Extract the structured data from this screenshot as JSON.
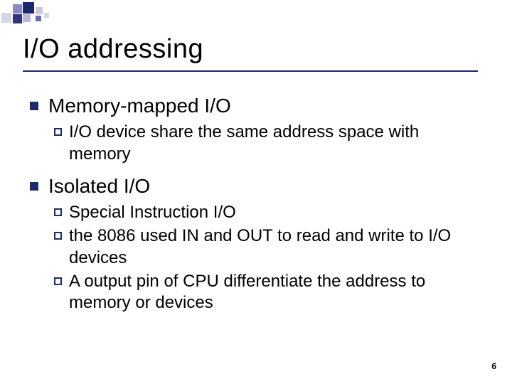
{
  "title": "I/O addressing",
  "sections": [
    {
      "heading": "Memory-mapped I/O",
      "items": [
        "I/O device share the same address space with memory"
      ]
    },
    {
      "heading": "Isolated I/O",
      "items": [
        "Special Instruction I/O",
        "the 8086 used IN and OUT to read and write to I/O devices",
        "A output pin of CPU differentiate the address to memory or devices"
      ]
    }
  ],
  "page_number": "6",
  "colors": {
    "accent": "#1a2a6c"
  }
}
